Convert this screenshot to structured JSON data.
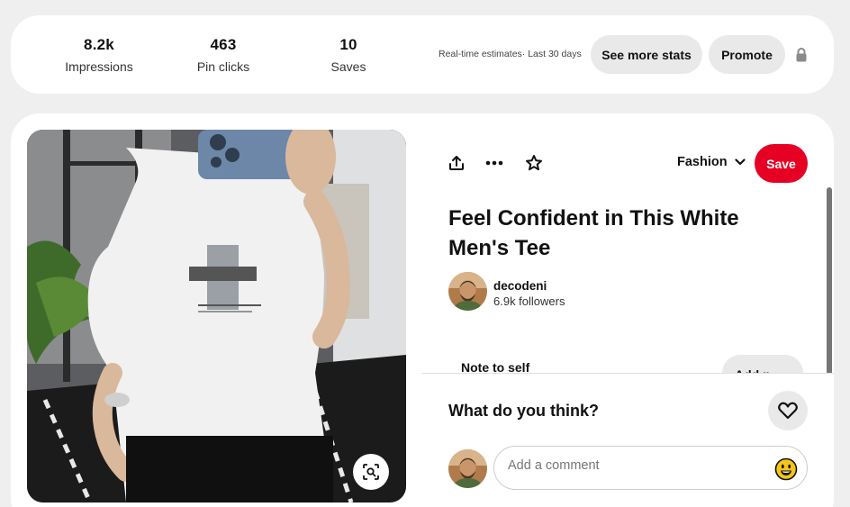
{
  "stats": {
    "items": [
      {
        "value": "8.2k",
        "label": "Impressions"
      },
      {
        "value": "463",
        "label": "Pin clicks"
      },
      {
        "value": "10",
        "label": "Saves"
      }
    ],
    "estimates_note": "Real-time estimates· Last 30 days",
    "see_more_label": "See more stats",
    "promote_label": "Promote",
    "lock_icon": "lock-icon"
  },
  "pin": {
    "board": "Fashion",
    "save_label": "Save",
    "title": "Feel Confident in This White Men's Tee",
    "author": {
      "name": "decodeni",
      "followers": "6.9k followers"
    },
    "note_label": "Note to self",
    "note_button_label": "Add n...",
    "icons": [
      "share-icon",
      "more-icon",
      "star-icon",
      "chevron-down-icon",
      "visual-search-icon"
    ],
    "image_alt": "Man in white t-shirt taking a mirror selfie"
  },
  "comments": {
    "prompt": "What do you think?",
    "placeholder": "Add a comment",
    "icons": [
      "heart-icon",
      "emoji-icon"
    ]
  },
  "colors": {
    "accent_red": "#e60023",
    "pill_gray": "#e9e9e9",
    "page_bg": "#efefef"
  }
}
